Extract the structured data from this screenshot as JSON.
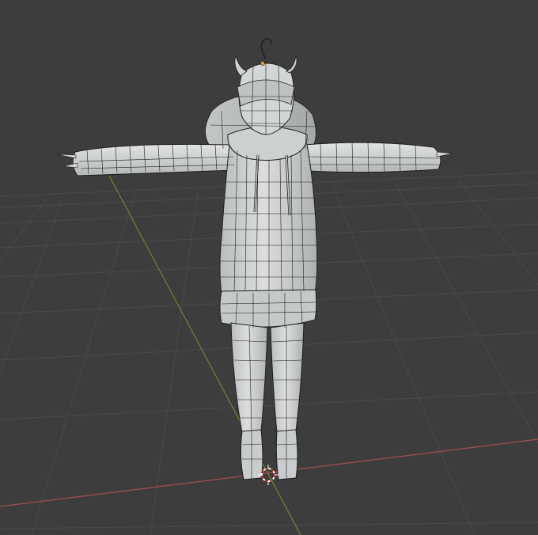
{
  "viewport": {
    "background": "#3d3d3d",
    "grid_color": "#4a4a4a",
    "x_axis_color": "#a2504f",
    "y_axis_color": "#6b8a2c",
    "cursor_colors": [
      "#e03030",
      "#ffffff"
    ],
    "mesh_fill": "#d7d9d9",
    "mesh_shade": "#a9acad",
    "wire_color": "#1f1f1f",
    "origin_color": "#f2a033"
  },
  "scene": {
    "object": "character-mesh",
    "shading": "solid",
    "overlay": "wireframe",
    "pose": "t-pose"
  }
}
